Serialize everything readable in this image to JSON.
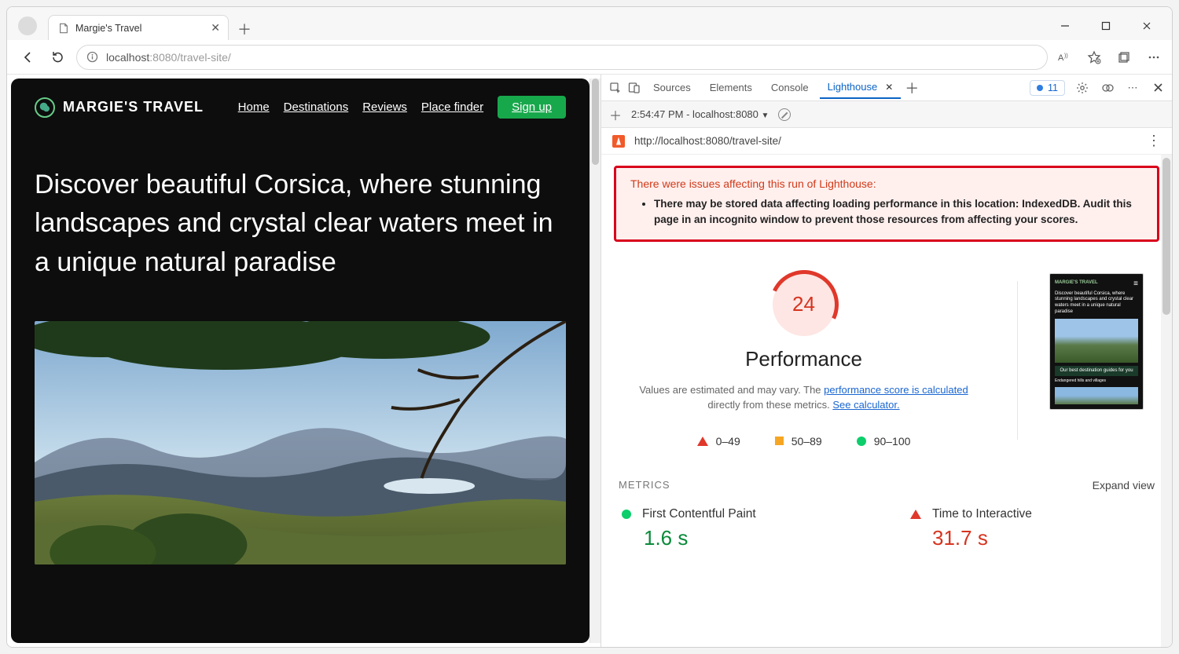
{
  "browser": {
    "tab_title": "Margie's Travel",
    "url_host": "localhost",
    "url_port": ":8080",
    "url_path": "/travel-site/",
    "issues_count": "11"
  },
  "site": {
    "brand": "MARGIE'S TRAVEL",
    "nav": {
      "home": "Home",
      "destinations": "Destinations",
      "reviews": "Reviews",
      "placefinder": "Place finder"
    },
    "signup": "Sign up",
    "hero": "Discover beautiful Corsica, where stunning landscapes and crystal clear waters meet in a unique natural paradise"
  },
  "devtools": {
    "tabs": {
      "sources": "Sources",
      "elements": "Elements",
      "console": "Console",
      "lighthouse": "Lighthouse"
    },
    "sub_time": "2:54:47 PM - localhost:8080",
    "audit_url": "http://localhost:8080/travel-site/",
    "warn_title": "There were issues affecting this run of Lighthouse:",
    "warn_item": "There may be stored data affecting loading performance in this location: IndexedDB. Audit this page in an incognito window to prevent those resources from affecting your scores.",
    "score": "24",
    "perf_title": "Performance",
    "perf_desc_1": "Values are estimated and may vary. The ",
    "perf_link_1": "performance score is calculated",
    "perf_desc_2": " directly from these metrics. ",
    "perf_link_2": "See calculator.",
    "legend": {
      "bad": "0–49",
      "mid": "50–89",
      "good": "90–100"
    },
    "metrics_label": "METRICS",
    "expand": "Expand view",
    "metric1": {
      "name": "First Contentful Paint",
      "value": "1.6 s"
    },
    "metric2": {
      "name": "Time to Interactive",
      "value": "31.7 s"
    },
    "mini": {
      "brand": "MARGIE'S TRAVEL",
      "hero": "Discover beautiful Corsica, where stunning landscapes and crystal clear waters meet in a unique natural paradise",
      "guides": "Our best destination guides for you",
      "sub": "Endangered hills and villages"
    }
  }
}
